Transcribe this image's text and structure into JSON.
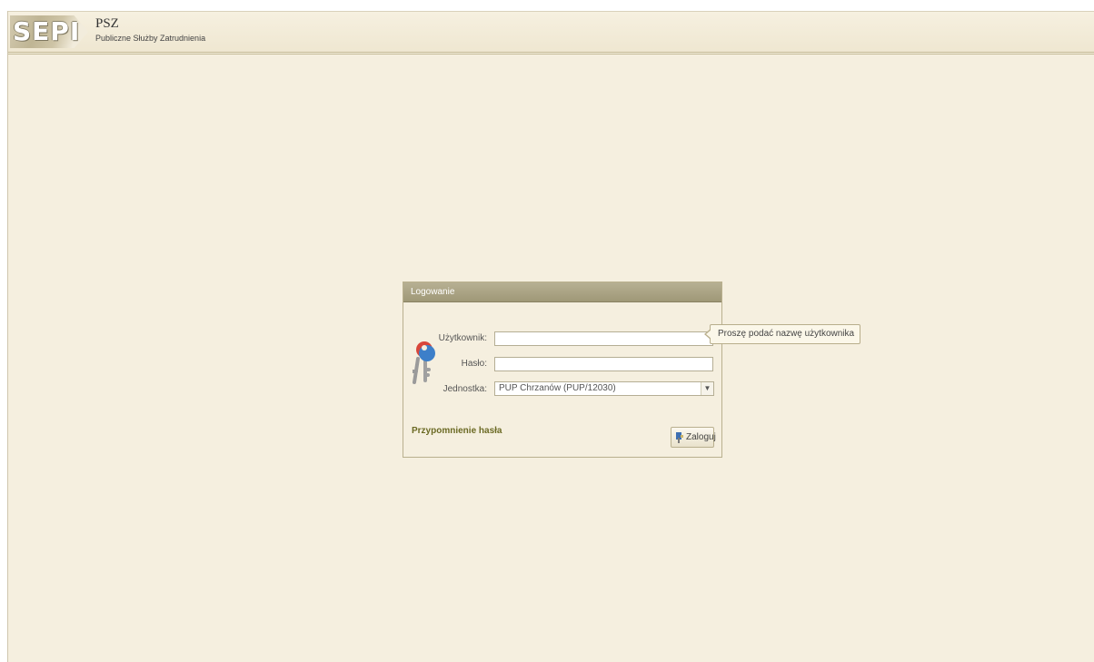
{
  "header": {
    "logo_text": "SEPI",
    "title": "PSZ",
    "subtitle": "Publiczne Służby Zatrudnienia"
  },
  "login": {
    "title": "Logowanie",
    "user_label": "Użytkownik:",
    "user_value": "",
    "password_label": "Hasło:",
    "password_value": "",
    "unit_label": "Jednostka:",
    "unit_value": "PUP Chrzanów (PUP/12030)",
    "forgot_link": "Przypomnienie hasła",
    "login_button": "Zaloguj",
    "tooltip": "Proszę podać nazwę użytkownika"
  },
  "icons": {
    "keys": "keys-icon",
    "select_arrow": "chevron-down-icon",
    "login": "login-icon"
  },
  "colors": {
    "background": "#f5efdf",
    "titlebar": "#a9a283",
    "link": "#6b6a24"
  }
}
